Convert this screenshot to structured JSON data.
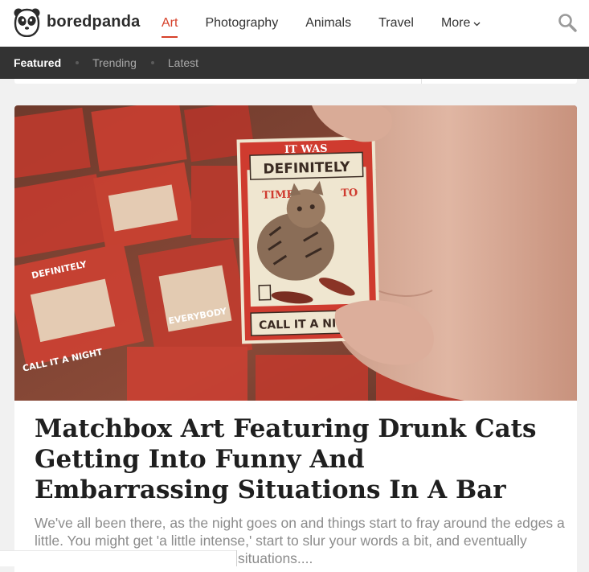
{
  "brand": {
    "name": "boredpanda",
    "accent_color": "#d6412a"
  },
  "nav": {
    "items": [
      {
        "label": "Art",
        "active": true
      },
      {
        "label": "Photography",
        "active": false
      },
      {
        "label": "Animals",
        "active": false
      },
      {
        "label": "Travel",
        "active": false
      },
      {
        "label": "More",
        "active": false
      }
    ],
    "search_icon": "search-icon"
  },
  "subnav": {
    "items": [
      {
        "label": "Featured",
        "active": true
      },
      {
        "label": "Trending",
        "active": false
      },
      {
        "label": "Latest",
        "active": false
      }
    ]
  },
  "article": {
    "image": {
      "box_line1": "IT WAS",
      "box_line2": "DEFINITELY",
      "box_line3a": "TIME",
      "box_line3b": "TO",
      "box_line4": "CALL IT A NIGHT",
      "side_label1": "DEFINITELY",
      "side_label2": "CALL IT A NIGHT",
      "side_label3": "EVERYBODY"
    },
    "title": "Matchbox Art Featuring Drunk Cats Getting Into Funny And Embarrassing Situations In A Bar",
    "excerpt": "We've all been there, as the night goes on and things start to fray around the edges a little. You might get 'a little intense,' start to slur your words a bit, and eventually",
    "excerpt_tail": "situations...."
  }
}
